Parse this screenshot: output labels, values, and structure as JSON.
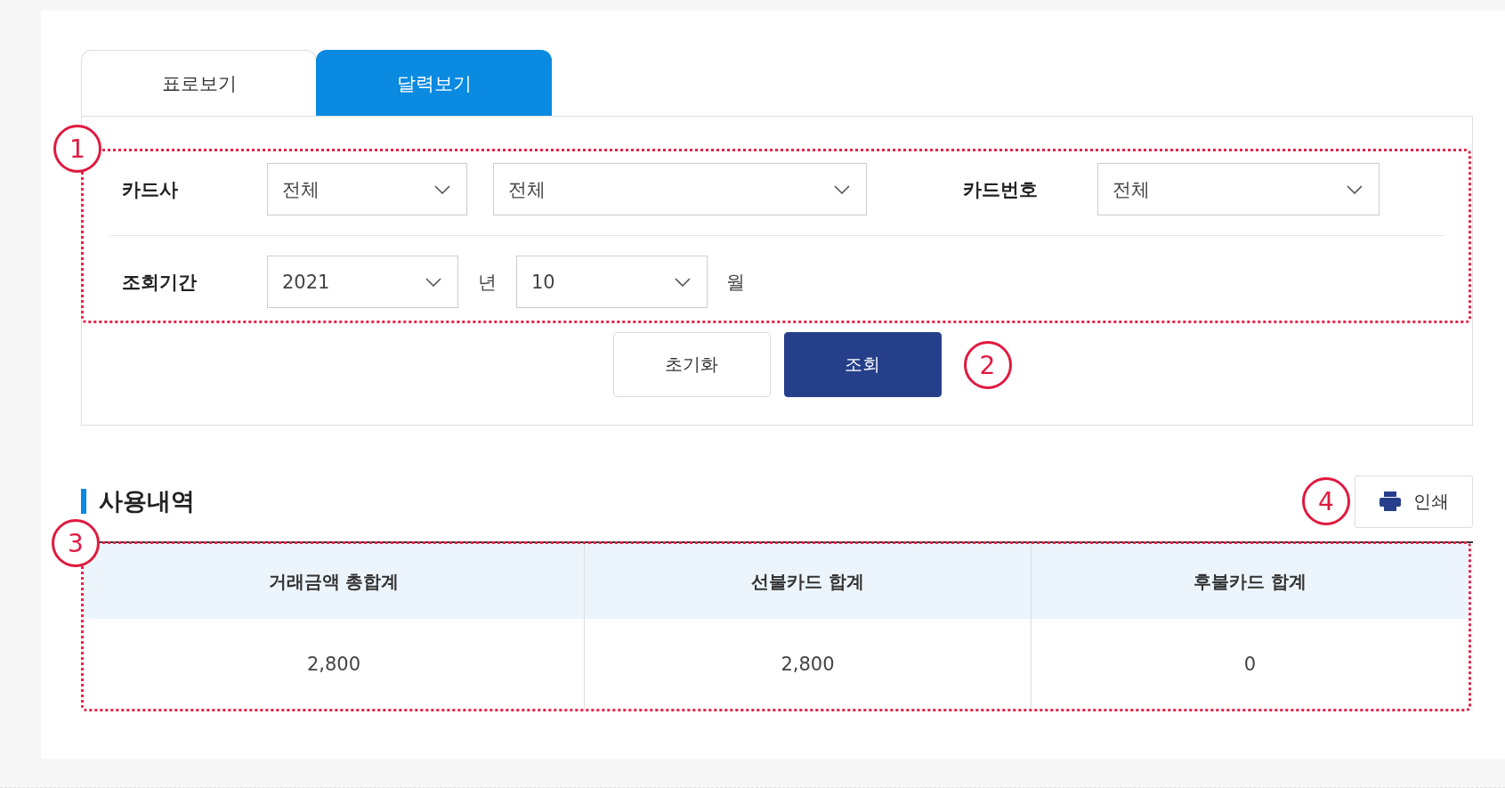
{
  "tabs": [
    {
      "label": "표로보기",
      "selected": false
    },
    {
      "label": "달력보기",
      "selected": true
    }
  ],
  "filter": {
    "callout": "1",
    "rows": [
      {
        "label": "카드사",
        "items": [
          {
            "kind": "select",
            "value": "전체"
          },
          {
            "kind": "select",
            "value": "전체"
          },
          {
            "kind": "label",
            "text": "카드번호"
          },
          {
            "kind": "select",
            "value": "전체"
          }
        ]
      },
      {
        "label": "조회기간",
        "items": [
          {
            "kind": "select",
            "value": "2021"
          },
          {
            "kind": "unit",
            "text": "년"
          },
          {
            "kind": "select",
            "value": "10"
          },
          {
            "kind": "unit",
            "text": "월"
          }
        ]
      }
    ]
  },
  "buttons": {
    "callout": "2",
    "items": [
      {
        "kind": "secondary",
        "label": "초기화"
      },
      {
        "kind": "primary",
        "label": "조회"
      }
    ]
  },
  "section": {
    "title": "사용내역",
    "print_button": "인쇄",
    "print_callout": "4"
  },
  "table": {
    "callout": "3",
    "columns": [
      "거래금액 총합계",
      "선불카드 합계",
      "후불카드 합계"
    ],
    "rows": [
      [
        "2,800",
        "2,800",
        "0"
      ]
    ]
  }
}
